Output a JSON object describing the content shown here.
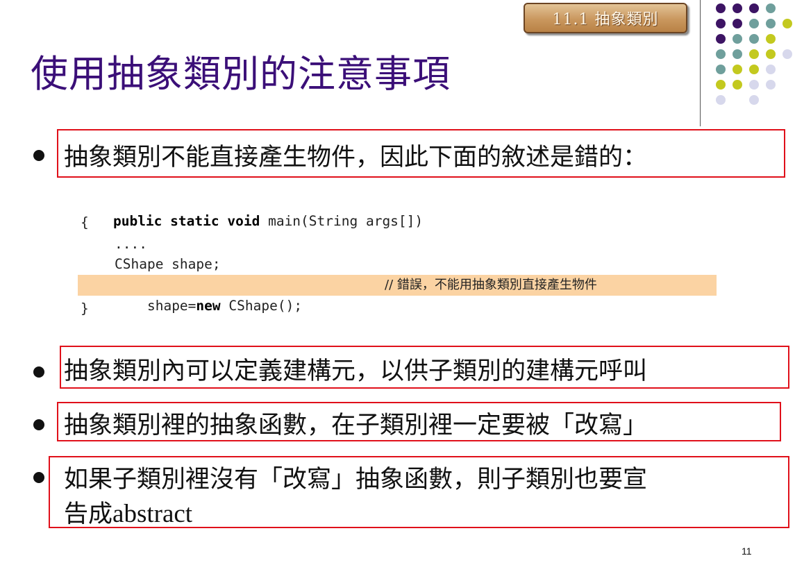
{
  "section_tab": "11.1  抽象類別",
  "title": "使用抽象類別的注意事項",
  "bullets": [
    "抽象類別不能直接產生物件，因此下面的敘述是錯的：",
    "抽象類別內可以定義建構元，以供子類別的建構元呼叫",
    "抽象類別裡的抽象函數，在子類別裡一定要被「改寫」",
    "如果子類別裡沒有「改寫」抽象函數，則子類別也要宣",
    "告成",
    "abstract"
  ],
  "code": {
    "kw_public": "public",
    "kw_static": "static",
    "kw_void": "void",
    "sig_rest": " main(String args[])",
    "open_brace": "{",
    "ellipsis": "....",
    "decl": "CShape shape;",
    "assign_pre": "shape=",
    "kw_new": "new",
    "assign_post": " CShape();",
    "comment": "// 錯誤，不能用抽象類別直接產生物件",
    "close_brace": "}"
  },
  "page_number": "11",
  "colors": {
    "title": "#3b0f78",
    "box": "#e0101a",
    "highlight": "#fbd3a3",
    "dot_purple": "#3d1464",
    "dot_teal": "#6f9f9c",
    "dot_olive": "#c3c91f",
    "dot_lavender": "#d7d8ec"
  }
}
